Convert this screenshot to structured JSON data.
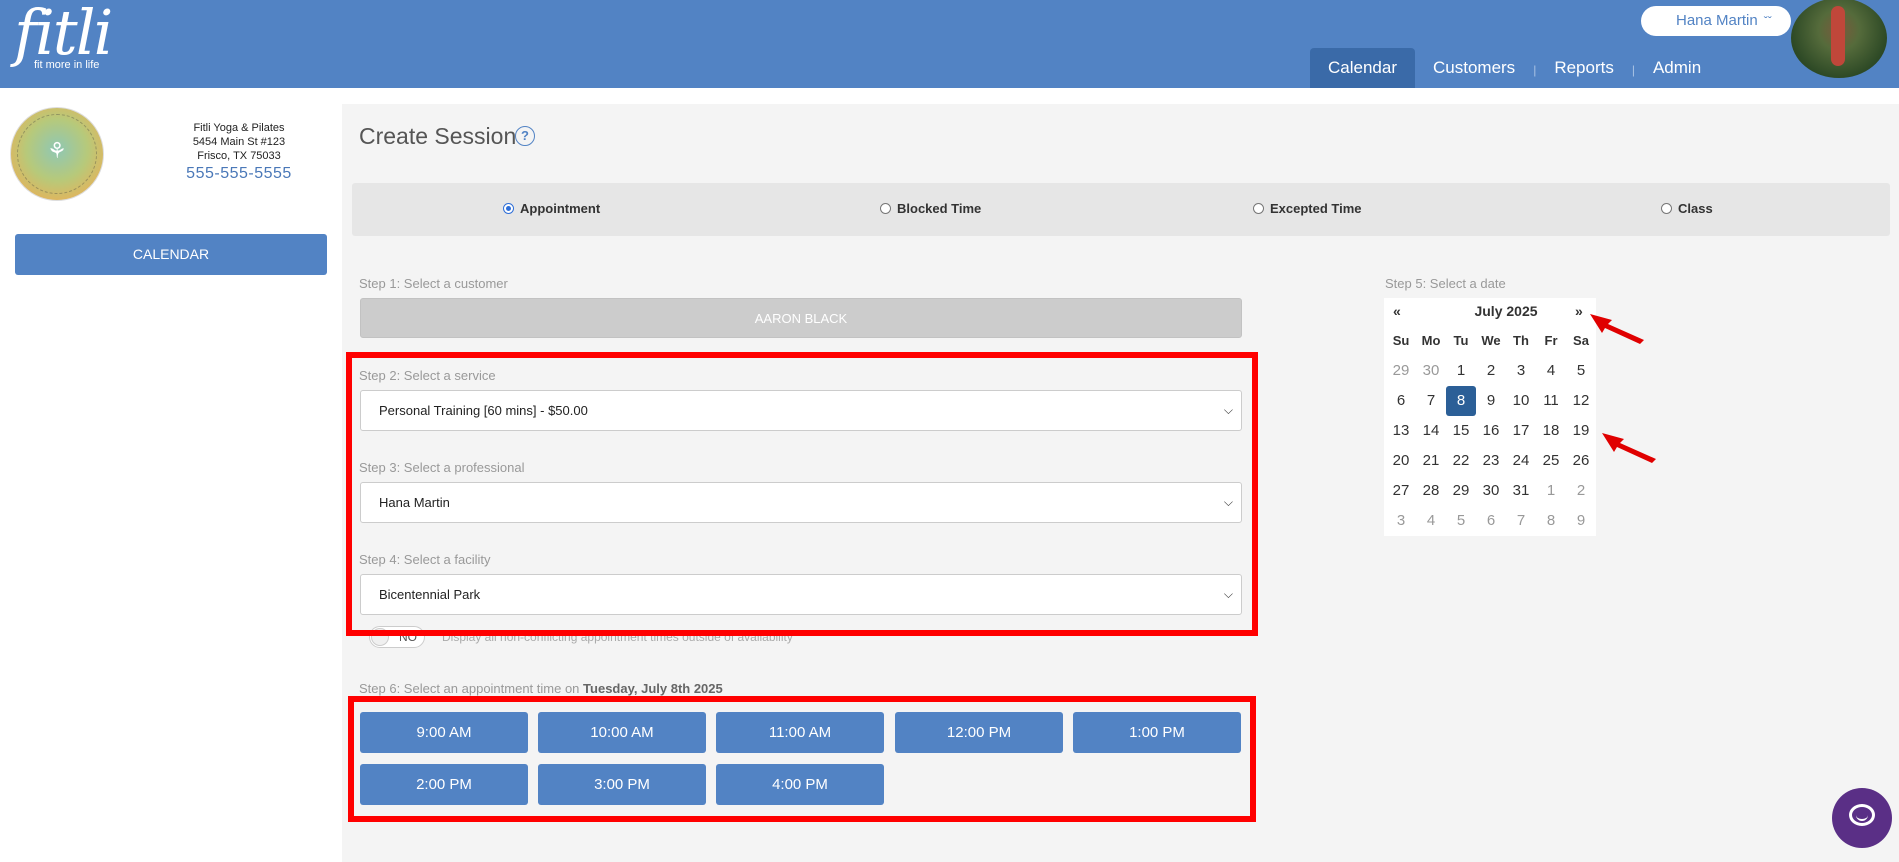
{
  "brand": {
    "logo": "fitli",
    "tagline": "fit more in life"
  },
  "user": {
    "name": "Hana Martin",
    "chevron_icon": "double-chevron-down-icon"
  },
  "nav": {
    "tabs": [
      {
        "label": "Calendar",
        "active": true
      },
      {
        "label": "Customers"
      },
      {
        "label": "Reports"
      },
      {
        "label": "Admin"
      }
    ],
    "separator": "|"
  },
  "studio": {
    "logo_text": "FITLI YOGA & PILATES",
    "name": "Fitli Yoga & Pilates",
    "address1": "5454 Main St #123",
    "address2": "Frisco, TX 75033",
    "phone": "555-555-5555",
    "calendar_button": "CALENDAR"
  },
  "page": {
    "title": "Create Session",
    "help_icon": "?"
  },
  "session_types": [
    {
      "label": "Appointment",
      "selected": true
    },
    {
      "label": "Blocked Time",
      "selected": false
    },
    {
      "label": "Excepted Time",
      "selected": false
    },
    {
      "label": "Class",
      "selected": false
    }
  ],
  "steps": {
    "customer": {
      "label": "Step 1: Select a customer",
      "value": "AARON BLACK"
    },
    "service": {
      "label": "Step 2: Select a service",
      "value": "Personal Training [60 mins] - $50.00"
    },
    "professional": {
      "label": "Step 3: Select a professional",
      "value": "Hana Martin"
    },
    "facility": {
      "label": "Step 4: Select a facility",
      "value": "Bicentennial Park"
    },
    "toggle": {
      "state": "NO",
      "description": "Display all non-conflicting appointment times outside of availability"
    },
    "date": {
      "label": "Step 5: Select a date"
    },
    "time": {
      "label_prefix": "Step 6: Select an appointment time on",
      "date_text": "Tuesday, July 8th 2025"
    }
  },
  "times": [
    "9:00 AM",
    "10:00 AM",
    "11:00 AM",
    "12:00 PM",
    "1:00 PM",
    "2:00 PM",
    "3:00 PM",
    "4:00 PM"
  ],
  "calendar": {
    "prev": "«",
    "next": "»",
    "month": "July 2025",
    "dow": [
      "Su",
      "Mo",
      "Tu",
      "We",
      "Th",
      "Fr",
      "Sa"
    ],
    "weeks": [
      [
        "29",
        "30",
        "1",
        "2",
        "3",
        "4",
        "5"
      ],
      [
        "6",
        "7",
        "8",
        "9",
        "10",
        "11",
        "12"
      ],
      [
        "13",
        "14",
        "15",
        "16",
        "17",
        "18",
        "19"
      ],
      [
        "20",
        "21",
        "22",
        "23",
        "24",
        "25",
        "26"
      ],
      [
        "27",
        "28",
        "29",
        "30",
        "31",
        "1",
        "2"
      ],
      [
        "3",
        "4",
        "5",
        "6",
        "7",
        "8",
        "9"
      ]
    ],
    "selected": "8"
  },
  "colors": {
    "primary": "#5283c4",
    "active_tab": "#3a6aa8",
    "selected_day": "#2b5f97",
    "highlight": "#ff0000",
    "chat": "#5a2f86"
  }
}
